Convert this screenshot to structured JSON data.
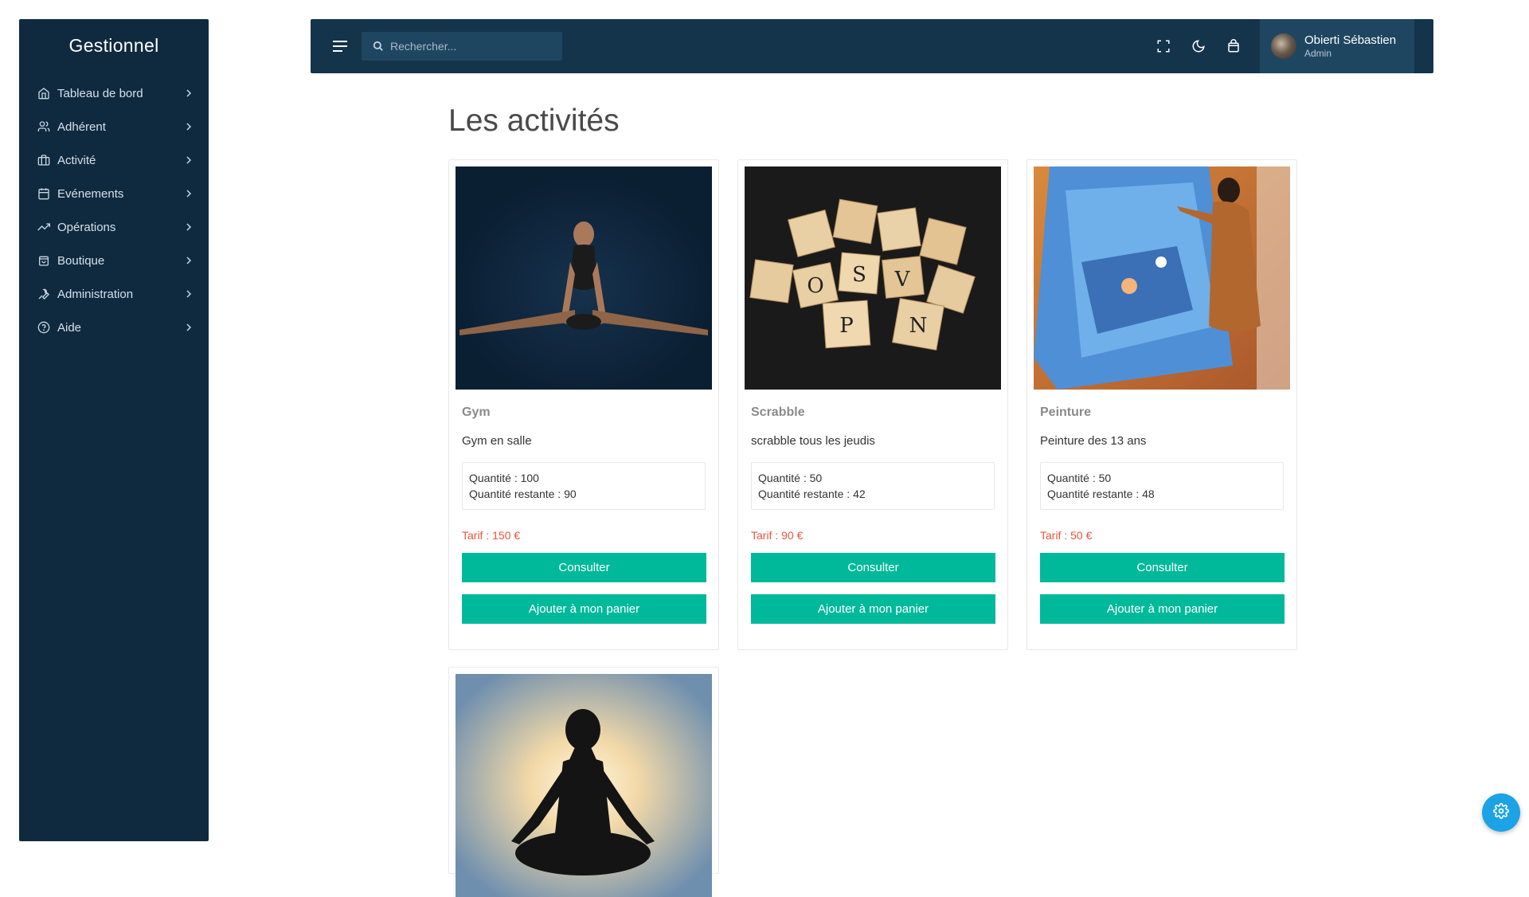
{
  "sidebar": {
    "brand": "Gestionnel",
    "items": [
      {
        "label": "Tableau de bord",
        "icon": "home-icon"
      },
      {
        "label": "Adhérent",
        "icon": "users-icon"
      },
      {
        "label": "Activité",
        "icon": "briefcase-icon"
      },
      {
        "label": "Evénements",
        "icon": "calendar-icon"
      },
      {
        "label": "Opérations",
        "icon": "trending-up-icon"
      },
      {
        "label": "Boutique",
        "icon": "shopping-bag-icon"
      },
      {
        "label": "Administration",
        "icon": "wrench-icon"
      },
      {
        "label": "Aide",
        "icon": "help-circle-icon"
      }
    ]
  },
  "topbar": {
    "search_placeholder": "Rechercher...",
    "user": {
      "name": "Obierti Sébastien",
      "role": "Admin"
    },
    "icons": [
      "menu-icon",
      "search-icon",
      "fullscreen-icon",
      "moon-icon",
      "shopping-bag-icon"
    ]
  },
  "page": {
    "title": "Les activités",
    "cards": [
      {
        "title": "Gym",
        "description": "Gym en salle",
        "quantity": "Quantité : 100",
        "remaining": "Quantité restante : 90",
        "price": "Tarif : 150 €",
        "consult": "Consulter",
        "add": "Ajouter à mon panier"
      },
      {
        "title": "Scrabble",
        "description": "scrabble tous les jeudis",
        "quantity": "Quantité : 50",
        "remaining": "Quantité restante : 42",
        "price": "Tarif : 90 €",
        "consult": "Consulter",
        "add": "Ajouter à mon panier"
      },
      {
        "title": "Peinture",
        "description": "Peinture des 13 ans",
        "quantity": "Quantité : 50",
        "remaining": "Quantité restante : 48",
        "price": "Tarif : 50 €",
        "consult": "Consulter",
        "add": "Ajouter à mon panier"
      }
    ]
  },
  "colors": {
    "sidebar_bg": "#0f2a3f",
    "topbar_bg": "#14344c",
    "accent": "#00b99a",
    "price": "#e8553f",
    "fab": "#1ba3e6"
  }
}
